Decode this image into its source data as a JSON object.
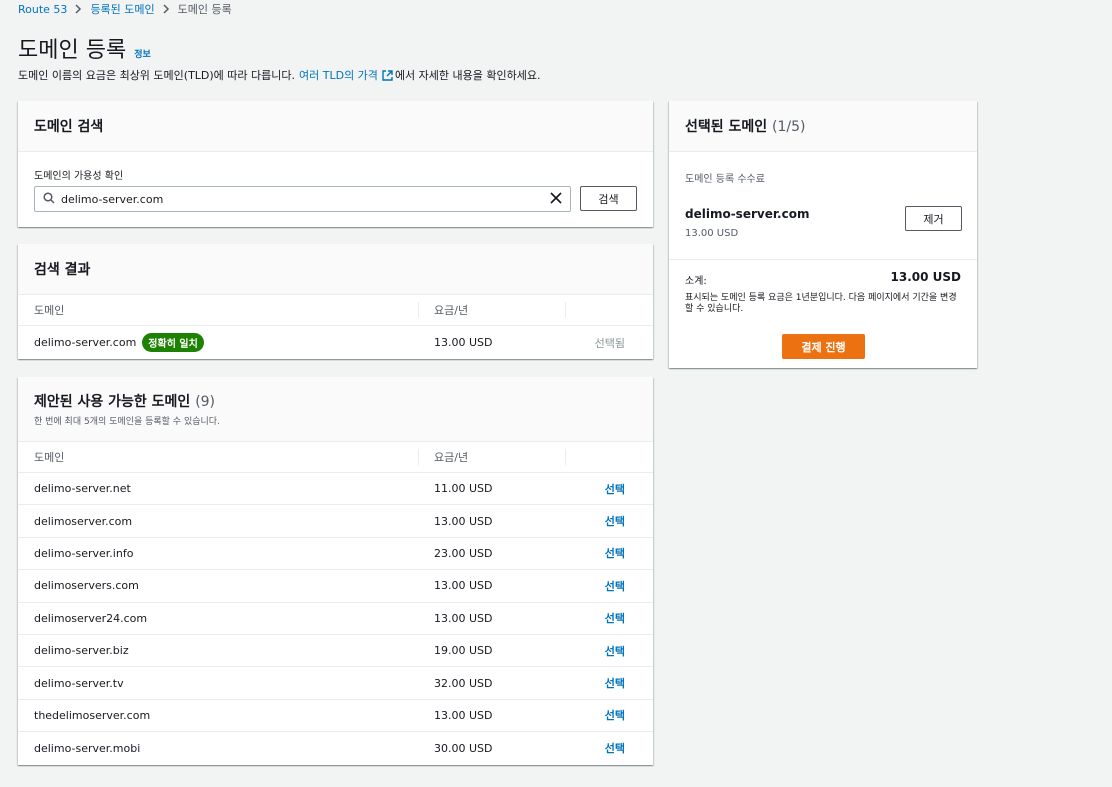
{
  "breadcrumb": [
    "Route 53",
    "등록된 도메인",
    "도메인 등록"
  ],
  "page": {
    "title": "도메인 등록",
    "info": "정보",
    "desc_before": "도메인 이름의 요금은 최상위 도메인(TLD)에 따라 다릅니다.",
    "desc_link": "여러 TLD의 가격",
    "desc_after": "에서 자세한 내용을 확인하세요."
  },
  "search": {
    "header": "도메인 검색",
    "label": "도메인의 가용성 확인",
    "value": "delimo-server.com",
    "button": "검색"
  },
  "results": {
    "header": "검색 결과",
    "col_domain": "도메인",
    "col_price": "요금/년",
    "row": {
      "domain": "delimo-server.com",
      "badge": "정확히 일치",
      "price": "13.00 USD",
      "action": "선택됨"
    }
  },
  "suggested": {
    "title": "제안된 사용 가능한 도메인",
    "count": "(9)",
    "subtitle": "한 번에 최대 5개의 도메인을 등록할 수 있습니다.",
    "col_domain": "도메인",
    "col_price": "요금/년",
    "action": "선택",
    "rows": [
      {
        "domain": "delimo-server.net",
        "price": "11.00 USD"
      },
      {
        "domain": "delimoserver.com",
        "price": "13.00 USD"
      },
      {
        "domain": "delimo-server.info",
        "price": "23.00 USD"
      },
      {
        "domain": "delimoservers.com",
        "price": "13.00 USD"
      },
      {
        "domain": "delimoserver24.com",
        "price": "13.00 USD"
      },
      {
        "domain": "delimo-server.biz",
        "price": "19.00 USD"
      },
      {
        "domain": "delimo-server.tv",
        "price": "32.00 USD"
      },
      {
        "domain": "thedelimoserver.com",
        "price": "13.00 USD"
      },
      {
        "domain": "delimo-server.mobi",
        "price": "30.00 USD"
      }
    ]
  },
  "selected": {
    "title": "선택된 도메인",
    "count": "(1/5)",
    "fee_label": "도메인 등록 수수료",
    "domain": "delimo-server.com",
    "price": "13.00 USD",
    "remove": "제거",
    "subtotal_label": "소계:",
    "subtotal_value": "13.00 USD",
    "note": "표시되는 도메인 등록 요금은 1년분입니다. 다음 페이지에서 기간을 변경할 수 있습니다.",
    "checkout": "결제 진행"
  },
  "colors": {
    "link": "#0073bb",
    "primary": "#ec7211",
    "badge": "#1d8102"
  }
}
